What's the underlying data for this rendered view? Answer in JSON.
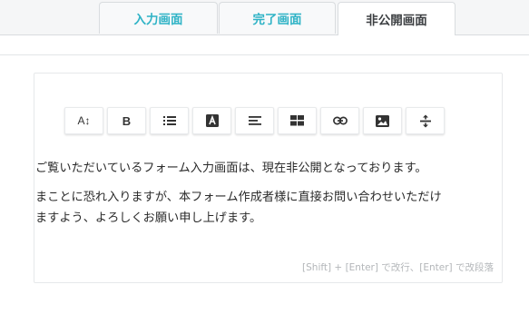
{
  "tabs": [
    {
      "label": "入力画面",
      "active": false
    },
    {
      "label": "完了画面",
      "active": false
    },
    {
      "label": "非公開画面",
      "active": true
    }
  ],
  "toolbar": {
    "buttons": [
      {
        "name": "font-size-button",
        "icon": "font-size-icon",
        "glyph": "A↕"
      },
      {
        "name": "bold-button",
        "icon": "bold-icon",
        "glyph": "B"
      },
      {
        "name": "bulleted-list-button",
        "icon": "bulleted-list-icon"
      },
      {
        "name": "text-color-button",
        "icon": "text-color-icon"
      },
      {
        "name": "align-left-button",
        "icon": "align-left-icon"
      },
      {
        "name": "table-button",
        "icon": "table-icon"
      },
      {
        "name": "link-button",
        "icon": "link-icon"
      },
      {
        "name": "image-button",
        "icon": "image-icon"
      },
      {
        "name": "horizontal-rule-button",
        "icon": "horizontal-rule-icon"
      }
    ]
  },
  "editor": {
    "lines": [
      "ご覧いただいているフォーム入力画面は、現在非公開となっております。",
      "まことに恐れ入りますが、本フォーム作成者様に直接お問い合わせいただけ",
      "ますよう、よろしくお願い申し上げます。"
    ],
    "hint": "[Shift] + [Enter] で改行、[Enter] で改段落"
  },
  "colors": {
    "tab_text": "#2fb3c6",
    "active_tab_text": "#3c3f42",
    "body_text": "#2b2b2b",
    "hint_text": "#b3b6b9"
  }
}
